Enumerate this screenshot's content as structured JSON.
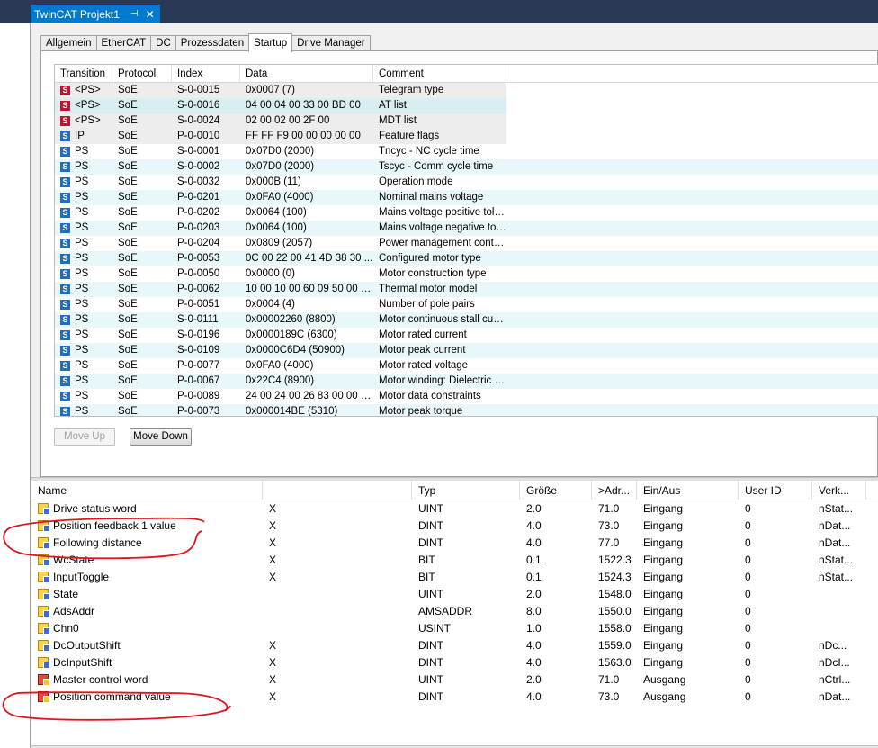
{
  "window": {
    "doc_tab_title": "TwinCAT Projekt1",
    "pin_glyph": "⊣",
    "close_glyph": "✕"
  },
  "tabs": [
    "Allgemein",
    "EtherCAT",
    "DC",
    "Prozessdaten",
    "Startup",
    "Drive Manager"
  ],
  "active_tab": "Startup",
  "startup": {
    "columns": [
      "Transition",
      "Protocol",
      "Index",
      "Data",
      "Comment"
    ],
    "rows": [
      {
        "icon": "red",
        "transition": "<PS>",
        "protocol": "SoE",
        "index": "S-0-0015",
        "data": "0x0007 (7)",
        "comment": "Telegram type"
      },
      {
        "icon": "red",
        "transition": "<PS>",
        "protocol": "SoE",
        "index": "S-0-0016",
        "data": "04 00 04 00 33 00 BD 00",
        "comment": "AT list"
      },
      {
        "icon": "red",
        "transition": "<PS>",
        "protocol": "SoE",
        "index": "S-0-0024",
        "data": "02 00 02 00 2F 00",
        "comment": "MDT list"
      },
      {
        "icon": "blue",
        "transition": "IP",
        "protocol": "SoE",
        "index": "P-0-0010",
        "data": "FF FF F9 00 00 00 00 00",
        "comment": "Feature flags"
      },
      {
        "icon": "blue",
        "transition": "PS",
        "protocol": "SoE",
        "index": "S-0-0001",
        "data": "0x07D0 (2000)",
        "comment": "Tncyc - NC cycle time"
      },
      {
        "icon": "blue",
        "transition": "PS",
        "protocol": "SoE",
        "index": "S-0-0002",
        "data": "0x07D0 (2000)",
        "comment": "Tscyc - Comm cycle time"
      },
      {
        "icon": "blue",
        "transition": "PS",
        "protocol": "SoE",
        "index": "S-0-0032",
        "data": "0x000B (11)",
        "comment": "Operation mode"
      },
      {
        "icon": "blue",
        "transition": "PS",
        "protocol": "SoE",
        "index": "P-0-0201",
        "data": "0x0FA0 (4000)",
        "comment": "Nominal mains voltage"
      },
      {
        "icon": "blue",
        "transition": "PS",
        "protocol": "SoE",
        "index": "P-0-0202",
        "data": "0x0064 (100)",
        "comment": "Mains voltage positive tole..."
      },
      {
        "icon": "blue",
        "transition": "PS",
        "protocol": "SoE",
        "index": "P-0-0203",
        "data": "0x0064 (100)",
        "comment": "Mains voltage negative tol..."
      },
      {
        "icon": "blue",
        "transition": "PS",
        "protocol": "SoE",
        "index": "P-0-0204",
        "data": "0x0809 (2057)",
        "comment": "Power management contro..."
      },
      {
        "icon": "blue",
        "transition": "PS",
        "protocol": "SoE",
        "index": "P-0-0053",
        "data": "0C 00 22 00 41 4D 38 30 ...",
        "comment": "Configured motor type"
      },
      {
        "icon": "blue",
        "transition": "PS",
        "protocol": "SoE",
        "index": "P-0-0050",
        "data": "0x0000 (0)",
        "comment": "Motor construction type"
      },
      {
        "icon": "blue",
        "transition": "PS",
        "protocol": "SoE",
        "index": "P-0-0062",
        "data": "10 00 10 00 60 09 50 00 6...",
        "comment": "Thermal motor model"
      },
      {
        "icon": "blue",
        "transition": "PS",
        "protocol": "SoE",
        "index": "P-0-0051",
        "data": "0x0004 (4)",
        "comment": "Number of pole pairs"
      },
      {
        "icon": "blue",
        "transition": "PS",
        "protocol": "SoE",
        "index": "S-0-0111",
        "data": "0x00002260 (8800)",
        "comment": "Motor continuous stall curr..."
      },
      {
        "icon": "blue",
        "transition": "PS",
        "protocol": "SoE",
        "index": "S-0-0196",
        "data": "0x0000189C (6300)",
        "comment": "Motor rated current"
      },
      {
        "icon": "blue",
        "transition": "PS",
        "protocol": "SoE",
        "index": "S-0-0109",
        "data": "0x0000C6D4 (50900)",
        "comment": "Motor peak current"
      },
      {
        "icon": "blue",
        "transition": "PS",
        "protocol": "SoE",
        "index": "P-0-0077",
        "data": "0x0FA0 (4000)",
        "comment": "Motor rated voltage"
      },
      {
        "icon": "blue",
        "transition": "PS",
        "protocol": "SoE",
        "index": "P-0-0067",
        "data": "0x22C4 (8900)",
        "comment": "Motor winding: Dielectric st..."
      },
      {
        "icon": "blue",
        "transition": "PS",
        "protocol": "SoE",
        "index": "P-0-0089",
        "data": "24 00 24 00 26 83 00 00 0...",
        "comment": "Motor data constraints"
      },
      {
        "icon": "blue",
        "transition": "PS",
        "protocol": "SoE",
        "index": "P-0-0073",
        "data": "0x000014BE (5310)",
        "comment": "Motor peak torque"
      }
    ],
    "move_up_label": "Move Up",
    "move_down_label": "Move Down"
  },
  "variables": {
    "columns": [
      "Name",
      "",
      "Typ",
      "Größe",
      ">Adr...",
      "Ein/Aus",
      "User ID",
      "Verk..."
    ],
    "rows": [
      {
        "dir": "in",
        "name": "Drive status word",
        "x": "X",
        "typ": "UINT",
        "size": "2.0",
        "addr": "71.0",
        "io": "Eingang",
        "uid": "0",
        "link": "nStat..."
      },
      {
        "dir": "in",
        "name": "Position feedback 1 value",
        "x": "X",
        "typ": "DINT",
        "size": "4.0",
        "addr": "73.0",
        "io": "Eingang",
        "uid": "0",
        "link": "nDat..."
      },
      {
        "dir": "in",
        "name": "Following distance",
        "x": "X",
        "typ": "DINT",
        "size": "4.0",
        "addr": "77.0",
        "io": "Eingang",
        "uid": "0",
        "link": "nDat..."
      },
      {
        "dir": "in",
        "name": "WcState",
        "x": "X",
        "typ": "BIT",
        "size": "0.1",
        "addr": "1522.3",
        "io": "Eingang",
        "uid": "0",
        "link": "nStat..."
      },
      {
        "dir": "in",
        "name": "InputToggle",
        "x": "X",
        "typ": "BIT",
        "size": "0.1",
        "addr": "1524.3",
        "io": "Eingang",
        "uid": "0",
        "link": "nStat..."
      },
      {
        "dir": "in",
        "name": "State",
        "x": "",
        "typ": "UINT",
        "size": "2.0",
        "addr": "1548.0",
        "io": "Eingang",
        "uid": "0",
        "link": ""
      },
      {
        "dir": "in",
        "name": "AdsAddr",
        "x": "",
        "typ": "AMSADDR",
        "size": "8.0",
        "addr": "1550.0",
        "io": "Eingang",
        "uid": "0",
        "link": ""
      },
      {
        "dir": "in",
        "name": "Chn0",
        "x": "",
        "typ": "USINT",
        "size": "1.0",
        "addr": "1558.0",
        "io": "Eingang",
        "uid": "0",
        "link": ""
      },
      {
        "dir": "in",
        "name": "DcOutputShift",
        "x": "X",
        "typ": "DINT",
        "size": "4.0",
        "addr": "1559.0",
        "io": "Eingang",
        "uid": "0",
        "link": "nDc..."
      },
      {
        "dir": "in",
        "name": "DcInputShift",
        "x": "X",
        "typ": "DINT",
        "size": "4.0",
        "addr": "1563.0",
        "io": "Eingang",
        "uid": "0",
        "link": "nDcI..."
      },
      {
        "dir": "out",
        "name": "Master control word",
        "x": "X",
        "typ": "UINT",
        "size": "2.0",
        "addr": "71.0",
        "io": "Ausgang",
        "uid": "0",
        "link": "nCtrl..."
      },
      {
        "dir": "out",
        "name": "Position command value",
        "x": "X",
        "typ": "DINT",
        "size": "4.0",
        "addr": "73.0",
        "io": "Ausgang",
        "uid": "0",
        "link": "nDat..."
      }
    ]
  },
  "colors": {
    "titlebar": "#293955",
    "doc_tab": "#007acc",
    "annotation": "#e0141e",
    "row_alt": "#e8f7f9"
  }
}
